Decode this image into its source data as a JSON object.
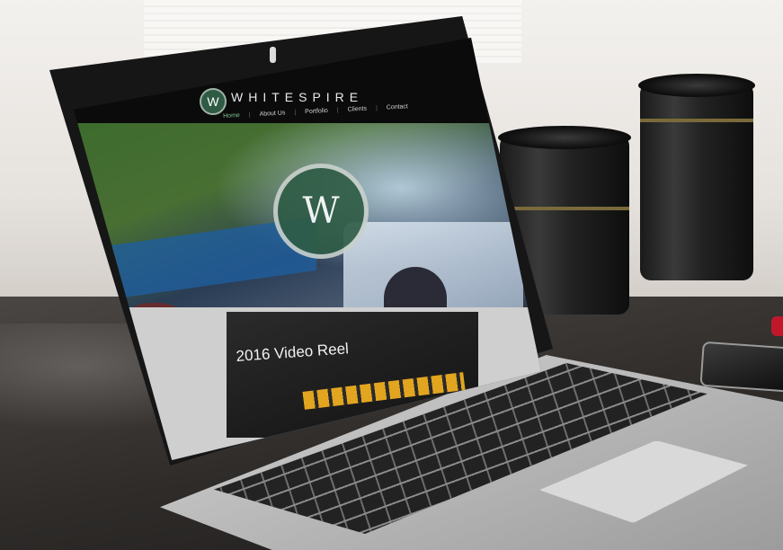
{
  "brand": {
    "logo_letter": "W",
    "name": "WHITESPIRE"
  },
  "nav": {
    "items": [
      {
        "label": "Home",
        "active": true
      },
      {
        "label": "About Us",
        "active": false
      },
      {
        "label": "Portfolio",
        "active": false
      },
      {
        "label": "Clients",
        "active": false
      },
      {
        "label": "Contact",
        "active": false
      }
    ]
  },
  "hero": {
    "emblem_letter": "W"
  },
  "video": {
    "title": "2016 Video Reel"
  },
  "colors": {
    "brand_green": "#2f5a44",
    "nav_active": "#7fbf8c",
    "accent_amber": "#e2a520"
  }
}
